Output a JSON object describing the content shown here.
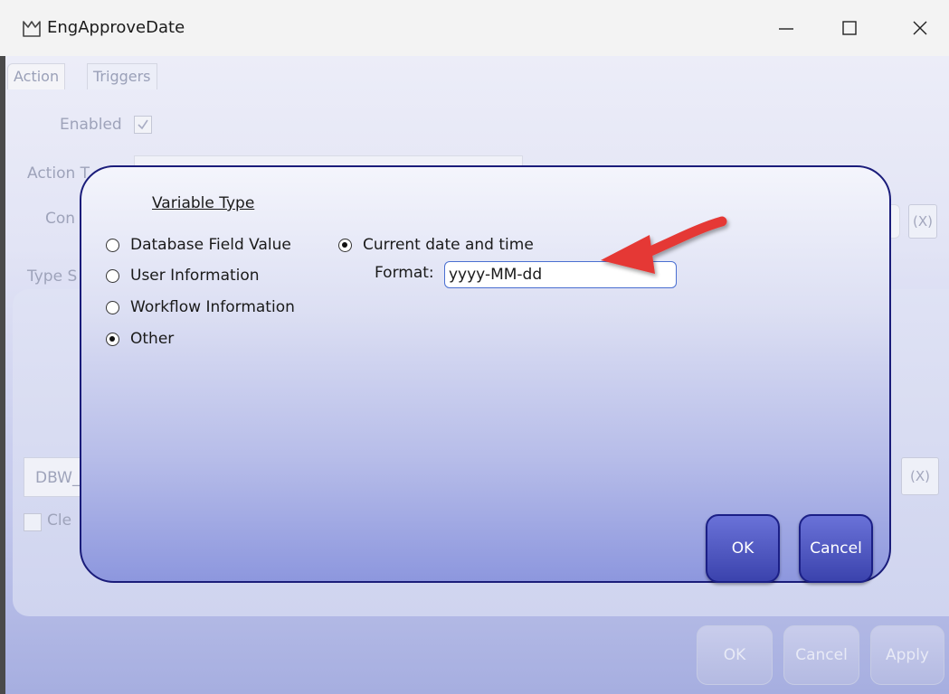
{
  "window": {
    "title": "EngApproveDate"
  },
  "background_form": {
    "tabs": [
      "Action",
      "Triggers"
    ],
    "enabled_label": "Enabled",
    "enabled_checked": true,
    "action_label": "Action T",
    "con_label": "Con",
    "type_label": "Type S",
    "x_button_label": "(X)",
    "dbw_field_value": "DBW_",
    "clear_label": "Cle",
    "buttons": {
      "ok": "OK",
      "cancel": "Cancel",
      "apply": "Apply"
    }
  },
  "dialog": {
    "title": "Variable Type",
    "left_options": [
      {
        "label": "Database Field Value",
        "checked": false
      },
      {
        "label": "User Information",
        "checked": false
      },
      {
        "label": "Workflow Information",
        "checked": false
      },
      {
        "label": "Other",
        "checked": true
      }
    ],
    "right_option": {
      "label": "Current date and time",
      "checked": true
    },
    "format_label": "Format:",
    "format_value": "yyyy-MM-dd",
    "ok_label": "OK",
    "cancel_label": "Cancel"
  },
  "colors": {
    "dialog_border": "#1a1c7a",
    "dialog_button": "#3b43ad",
    "annotation_arrow": "#e53935"
  },
  "icons": [
    "app-icon",
    "minimize-icon",
    "maximize-icon",
    "close-icon",
    "checkmark-icon",
    "annotation-arrow-icon"
  ]
}
